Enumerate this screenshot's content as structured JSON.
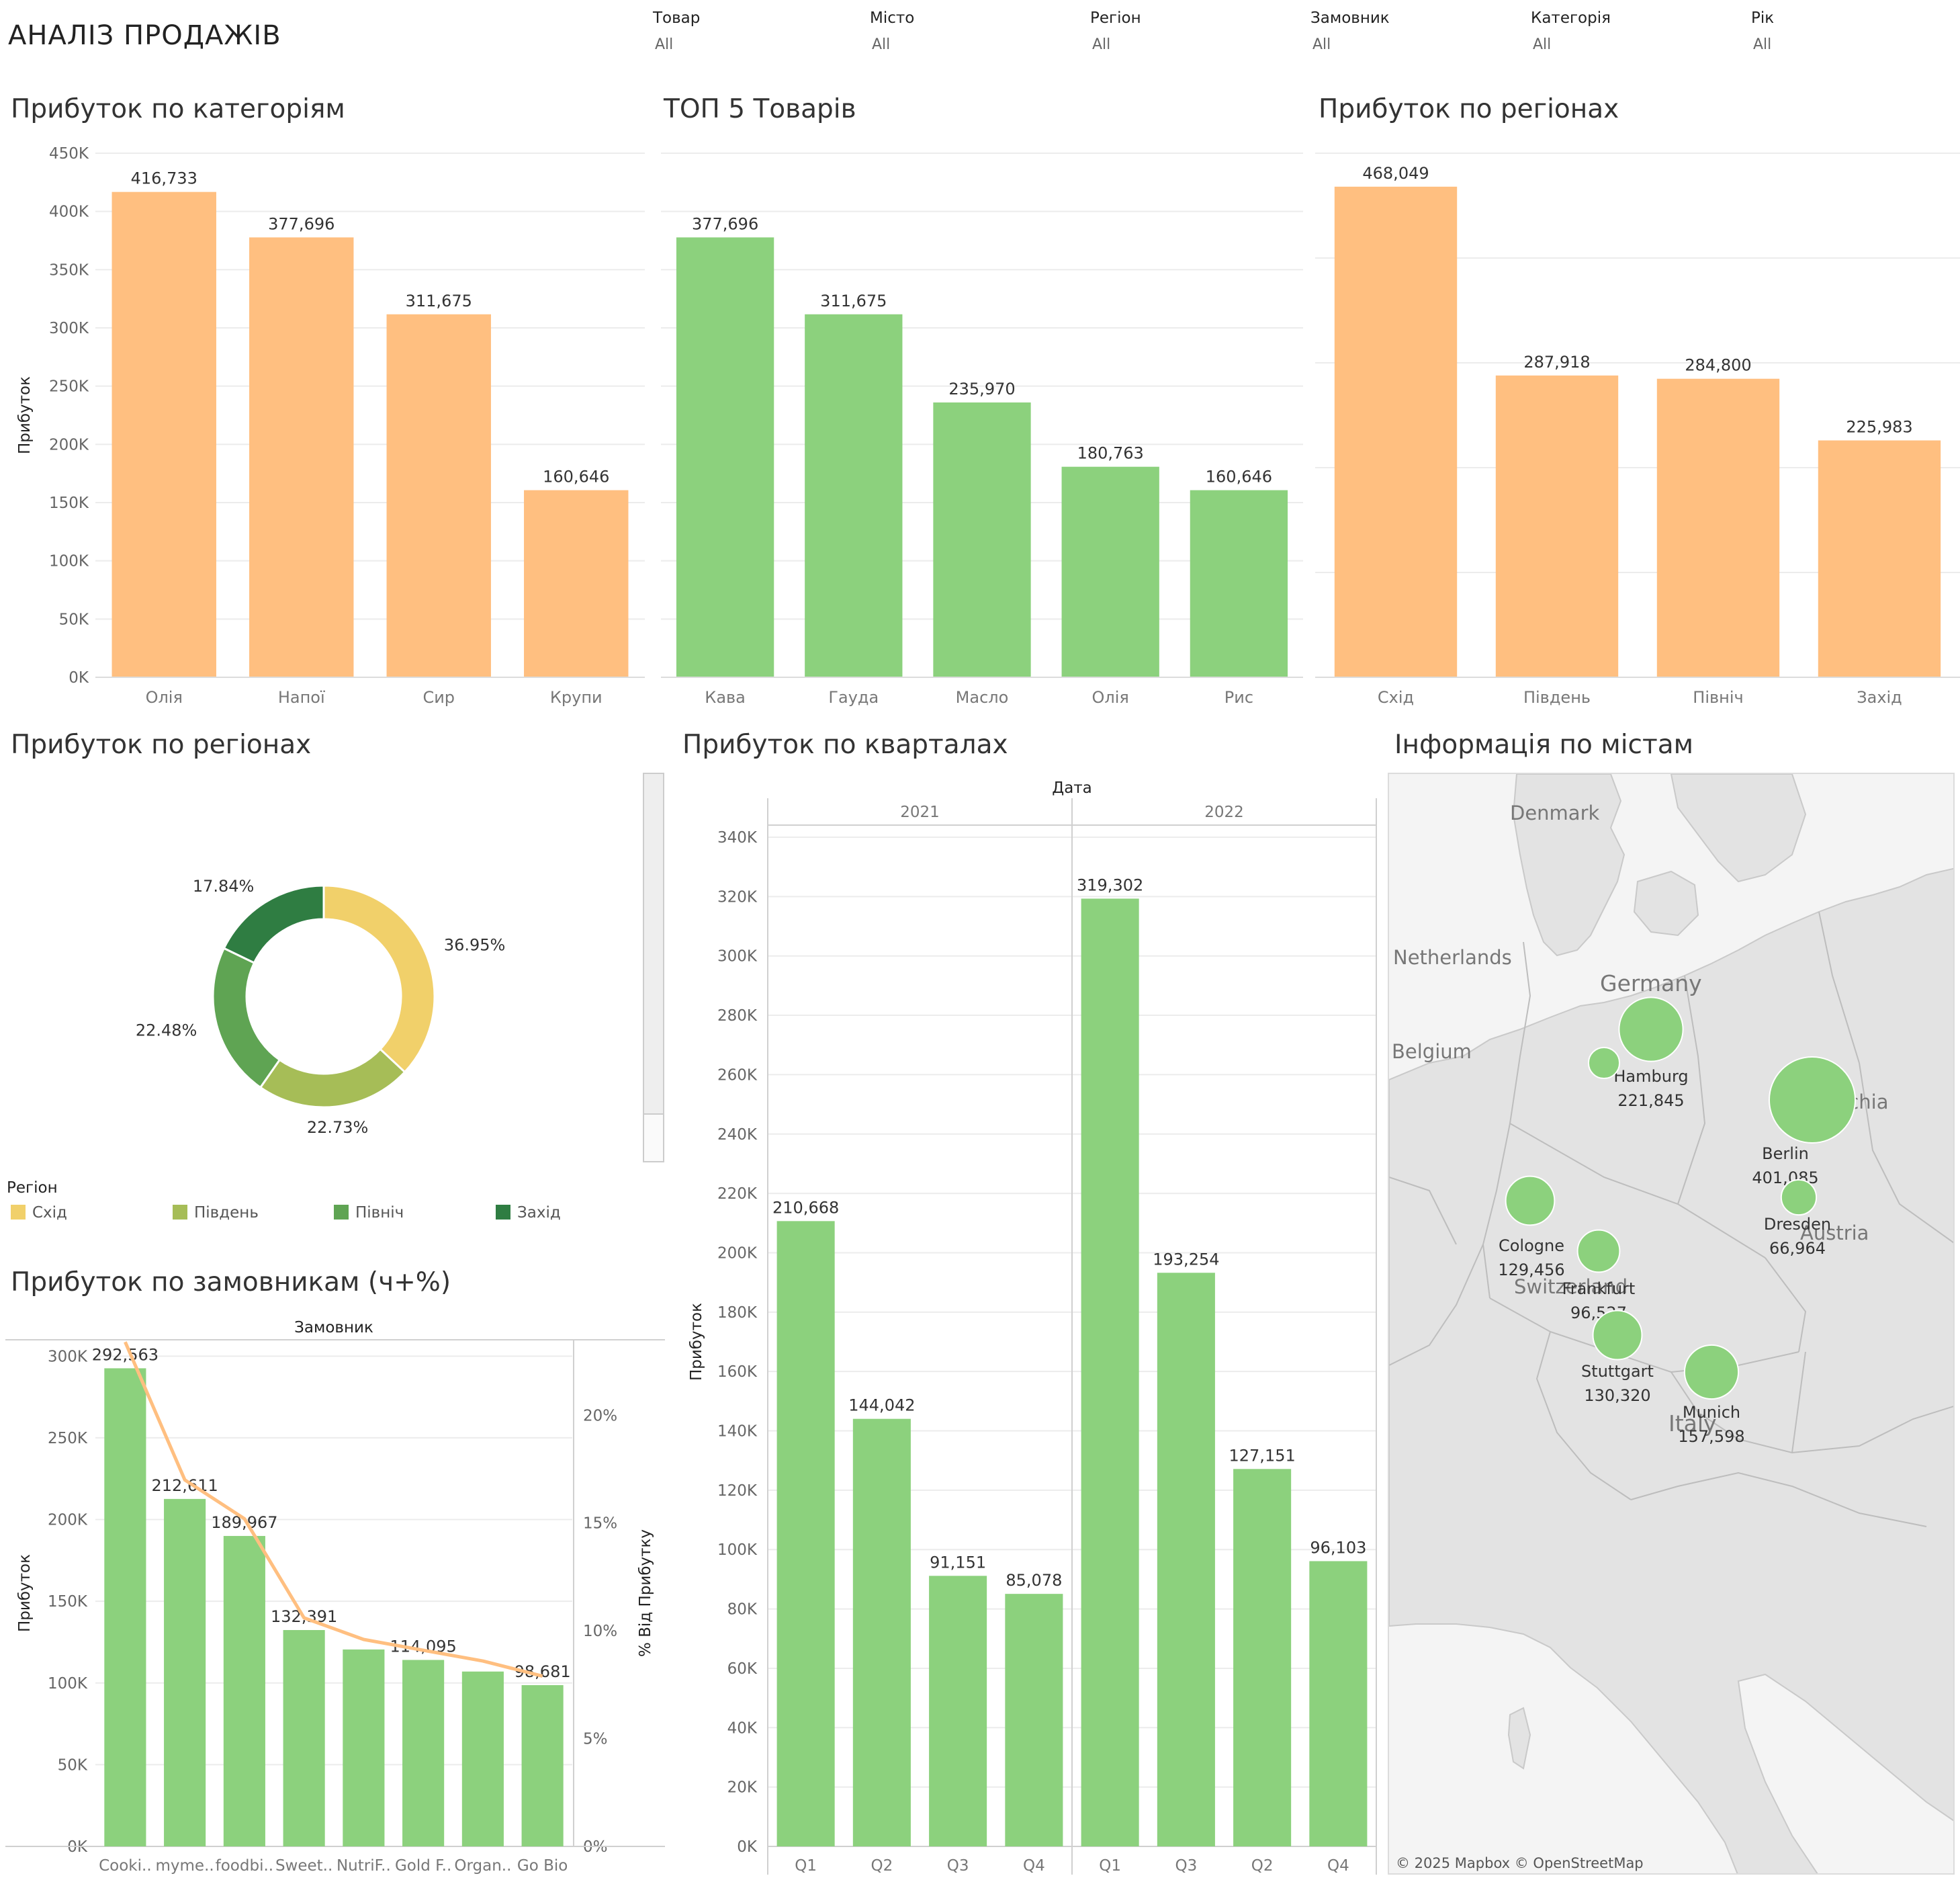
{
  "dashboard_title": "АНАЛІЗ ПРОДАЖІВ",
  "filters": [
    {
      "label": "Товар",
      "value": "All"
    },
    {
      "label": "Місто",
      "value": "All"
    },
    {
      "label": "Регіон",
      "value": "All"
    },
    {
      "label": "Замовник",
      "value": "All"
    },
    {
      "label": "Категорія",
      "value": "All"
    },
    {
      "label": "Рік",
      "value": "All"
    }
  ],
  "sections": {
    "categories": "Прибуток по категоріям",
    "top5": "ТОП 5 Товарів",
    "regions_bar": "Прибуток по регіонах",
    "regions_donut": "Прибуток по регіонах",
    "quarters": "Прибуток по кварталах",
    "cities": "Інформація по містам",
    "customers": "Прибуток по замовникам (ч+%)"
  },
  "colors": {
    "orange": "#ffbf80",
    "green": "#8cd17d",
    "pareto_line": "#ffbf80",
    "donut_east": "#f1d06a",
    "donut_south": "#a6bd57",
    "donut_north": "#5fa453",
    "donut_west": "#2f7d42",
    "map_land": "#e3e3e3",
    "map_water": "#f4f4f4",
    "bubble": "#8cd17d"
  },
  "chart_data": [
    {
      "id": "categories",
      "type": "bar",
      "ylabel": "Прибуток",
      "ylim": [
        0,
        450000
      ],
      "yticks": [
        "0K",
        "50K",
        "100K",
        "150K",
        "200K",
        "250K",
        "300K",
        "350K",
        "400K",
        "450K"
      ],
      "categories": [
        "Олія",
        "Напої",
        "Сир",
        "Крупи"
      ],
      "values": [
        416733,
        377696,
        311675,
        160646
      ],
      "value_labels": [
        "416,733",
        "377,696",
        "311,675",
        "160,646"
      ],
      "grid": true
    },
    {
      "id": "top5",
      "type": "bar",
      "ylim": [
        0,
        450000
      ],
      "categories": [
        "Кава",
        "Гауда",
        "Масло",
        "Олія",
        "Рис"
      ],
      "values": [
        377696,
        311675,
        235970,
        180763,
        160646
      ],
      "value_labels": [
        "377,696",
        "311,675",
        "235,970",
        "180,763",
        "160,646"
      ],
      "grid": true
    },
    {
      "id": "regions_bar",
      "type": "bar",
      "ylim": [
        0,
        500000
      ],
      "categories": [
        "Схід",
        "Південь",
        "Північ",
        "Захід"
      ],
      "values": [
        468049,
        287918,
        284800,
        225983
      ],
      "value_labels": [
        "468,049",
        "287,918",
        "284,800",
        "225,983"
      ],
      "grid": true
    },
    {
      "id": "regions_donut",
      "type": "pie",
      "legend_title": "Регіон",
      "legend_position": "bottom",
      "slices": [
        {
          "name": "Схід",
          "value": 36.95,
          "label": "36.95%"
        },
        {
          "name": "Південь",
          "value": 22.73,
          "label": "22.73%"
        },
        {
          "name": "Північ",
          "value": 22.48,
          "label": "22.48%"
        },
        {
          "name": "Захід",
          "value": 17.84,
          "label": "17.84%"
        }
      ]
    },
    {
      "id": "quarters",
      "type": "bar",
      "column_header": "Дата",
      "ylabel": "Прибуток",
      "ylim": [
        0,
        340000
      ],
      "yticks": [
        "0K",
        "20K",
        "40K",
        "60K",
        "80K",
        "100K",
        "120K",
        "140K",
        "160K",
        "180K",
        "200K",
        "220K",
        "240K",
        "260K",
        "280K",
        "300K",
        "320K",
        "340K"
      ],
      "groups": [
        {
          "name": "2021",
          "categories": [
            "Q1",
            "Q2",
            "Q3",
            "Q4"
          ],
          "values": [
            210668,
            144042,
            91151,
            85078
          ],
          "value_labels": [
            "210,668",
            "144,042",
            "91,151",
            "85,078"
          ]
        },
        {
          "name": "2022",
          "categories": [
            "Q1",
            "Q3",
            "Q2",
            "Q4"
          ],
          "values": [
            319302,
            193254,
            127151,
            96103
          ],
          "value_labels": [
            "319,302",
            "193,254",
            "127,151",
            "96,103"
          ]
        }
      ],
      "grid": true
    },
    {
      "id": "customers",
      "type": "bar",
      "column_header": "Замовник",
      "ylabel": "Прибуток",
      "y2label": "% Від Прибутку",
      "ylim": [
        0,
        310000
      ],
      "yticks": [
        "0K",
        "50K",
        "100K",
        "150K",
        "200K",
        "250K",
        "300K"
      ],
      "y2lim": [
        0,
        23.5
      ],
      "y2ticks": [
        "0%",
        "5%",
        "10%",
        "15%",
        "20%"
      ],
      "categories": [
        "Cooki..",
        "myme..",
        "foodbi..",
        "Sweet..",
        "NutriF..",
        "Gold F..",
        "Organ..",
        "Go Bio"
      ],
      "values": [
        292563,
        212611,
        189967,
        132391,
        120500,
        114095,
        107000,
        98681
      ],
      "value_labels": [
        "292,563",
        "212,611",
        "189,967",
        "132,391",
        "",
        "114,095",
        "",
        "98,681"
      ],
      "line_values_pct": [
        23.4,
        17.0,
        15.2,
        10.6,
        9.6,
        9.1,
        8.6,
        7.9
      ]
    }
  ],
  "map": {
    "country_labels": [
      "Denmark",
      "Netherlands",
      "Germany",
      "Belgium",
      "Czechia",
      "Austria",
      "Switzerland",
      "Italy"
    ],
    "cities": [
      {
        "name": "Hamburg",
        "value": "221,845",
        "profit": 221845
      },
      {
        "name": "Berlin",
        "value": "401,085",
        "profit": 401085
      },
      {
        "name": "Cologne",
        "value": "129,456",
        "profit": 129456
      },
      {
        "name": "Dresden",
        "value": "66,964",
        "profit": 66964
      },
      {
        "name": "Frankfurt",
        "value": "96,527",
        "profit": 96527
      },
      {
        "name": "Stuttgart",
        "value": "130,320",
        "profit": 130320
      },
      {
        "name": "Munich",
        "value": "157,598",
        "profit": 157598
      },
      {
        "name": "",
        "value": "",
        "profit": 52000
      }
    ],
    "attribution": "© 2025 Mapbox © OpenStreetMap"
  }
}
